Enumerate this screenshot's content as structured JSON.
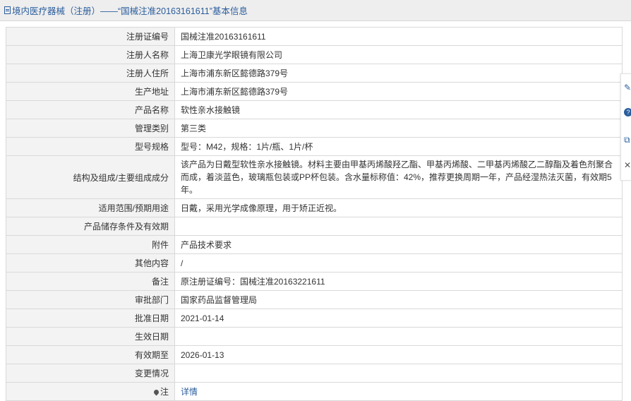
{
  "header": {
    "title": "境内医疗器械（注册）——“国械注准20163161611”基本信息"
  },
  "rows": [
    {
      "label": "注册证编号",
      "value": "国械注准20163161611"
    },
    {
      "label": "注册人名称",
      "value": "上海卫康光学眼镜有限公司"
    },
    {
      "label": "注册人住所",
      "value": "上海市浦东新区懿德路379号"
    },
    {
      "label": "生产地址",
      "value": "上海市浦东新区懿德路379号"
    },
    {
      "label": "产品名称",
      "value": "软性亲水接触镜"
    },
    {
      "label": "管理类别",
      "value": "第三类"
    },
    {
      "label": "型号规格",
      "value": "型号：M42，规格：1片/瓶、1片/杯"
    },
    {
      "label": "结构及组成/主要组成成分",
      "value": "该产品为日戴型软性亲水接触镜。材料主要由甲基丙烯酸羟乙酯、甲基丙烯酸、二甲基丙烯酸乙二醇酯及着色剂聚合而成，着淡蓝色，玻璃瓶包装或PP杯包装。含水量标称值：42%，推荐更换周期一年，产品经湿热法灭菌，有效期5年。"
    },
    {
      "label": "适用范围/预期用途",
      "value": "日戴，采用光学成像原理，用于矫正近视。"
    },
    {
      "label": "产品储存条件及有效期",
      "value": ""
    },
    {
      "label": "附件",
      "value": "产品技术要求"
    },
    {
      "label": "其他内容",
      "value": "/"
    },
    {
      "label": "备注",
      "value": "原注册证编号：国械注准20163221611"
    },
    {
      "label": "审批部门",
      "value": "国家药品监督管理局"
    },
    {
      "label": "批准日期",
      "value": "2021-01-14"
    },
    {
      "label": "生效日期",
      "value": ""
    },
    {
      "label": "有效期至",
      "value": "2026-01-13"
    },
    {
      "label": "变更情况",
      "value": ""
    }
  ],
  "note": {
    "label": "注",
    "link_text": "详情"
  },
  "side_tools": {
    "edit_glyph": "✎",
    "help_glyph": "?",
    "copy_glyph": "⧉",
    "close_glyph": "✕"
  }
}
